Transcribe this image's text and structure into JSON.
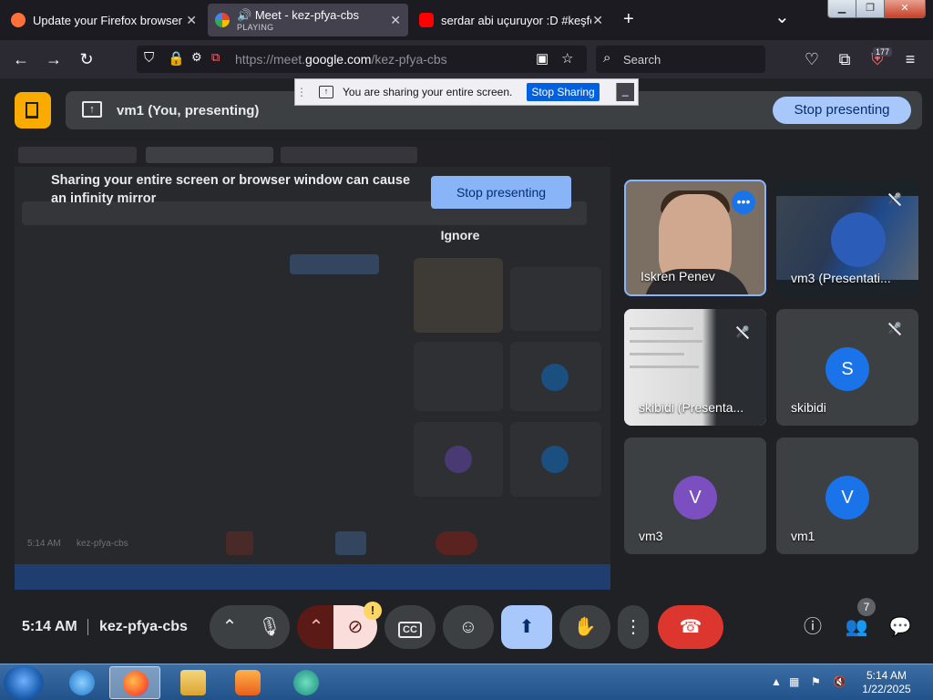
{
  "browser": {
    "tabs": [
      {
        "title": "Update your Firefox browser",
        "fav_color": "#ff7139",
        "active": false
      },
      {
        "title": "Meet - kez-pfya-cbs",
        "subtitle": "PLAYING",
        "fav_color": "#34a853",
        "active": true
      },
      {
        "title": "serdar abi uçuruyor :D #keşfet #",
        "fav_color": "#ff0000",
        "active": false
      }
    ],
    "new_tab": "+",
    "tab_list": "⌄",
    "url_prefix": "https://meet.",
    "url_domain": "google.com",
    "url_path": "/kez-pfya-cbs",
    "search_placeholder": "Search",
    "badge": "177"
  },
  "share_notification": {
    "text": "You are sharing your entire screen.",
    "stop_label": "Stop Sharing",
    "minimize": "_"
  },
  "meet": {
    "banner_text": "vm1 (You, presenting)",
    "stop_presenting": "Stop presenting",
    "mirror": {
      "warning": "Sharing your entire screen or browser window can cause an infinity mirror",
      "stop_presenting": "Stop presenting",
      "ignore": "Ignore"
    },
    "participants": [
      {
        "name": "Iskren Penev",
        "muted": false
      },
      {
        "name": "vm3 (Presentati...",
        "muted": true
      },
      {
        "name": "skibidi (Presenta...",
        "muted": true
      },
      {
        "name": "skibidi",
        "initial": "S",
        "color": "#1a73e8",
        "muted": true
      },
      {
        "name": "vm3",
        "initial": "V",
        "color": "#7b4fbf",
        "muted": false
      },
      {
        "name": "vm1",
        "initial": "V",
        "color": "#1a73e8",
        "muted": false
      }
    ],
    "bottom": {
      "time": "5:14 AM",
      "code": "kez-pfya-cbs",
      "warning_badge": "!",
      "people_count": "7"
    },
    "mirror_bottom": {
      "time": "5:14 AM",
      "code": "kez-pfya-cbs"
    }
  },
  "taskbar": {
    "clock_time": "5:14 AM",
    "clock_date": "1/22/2025"
  }
}
